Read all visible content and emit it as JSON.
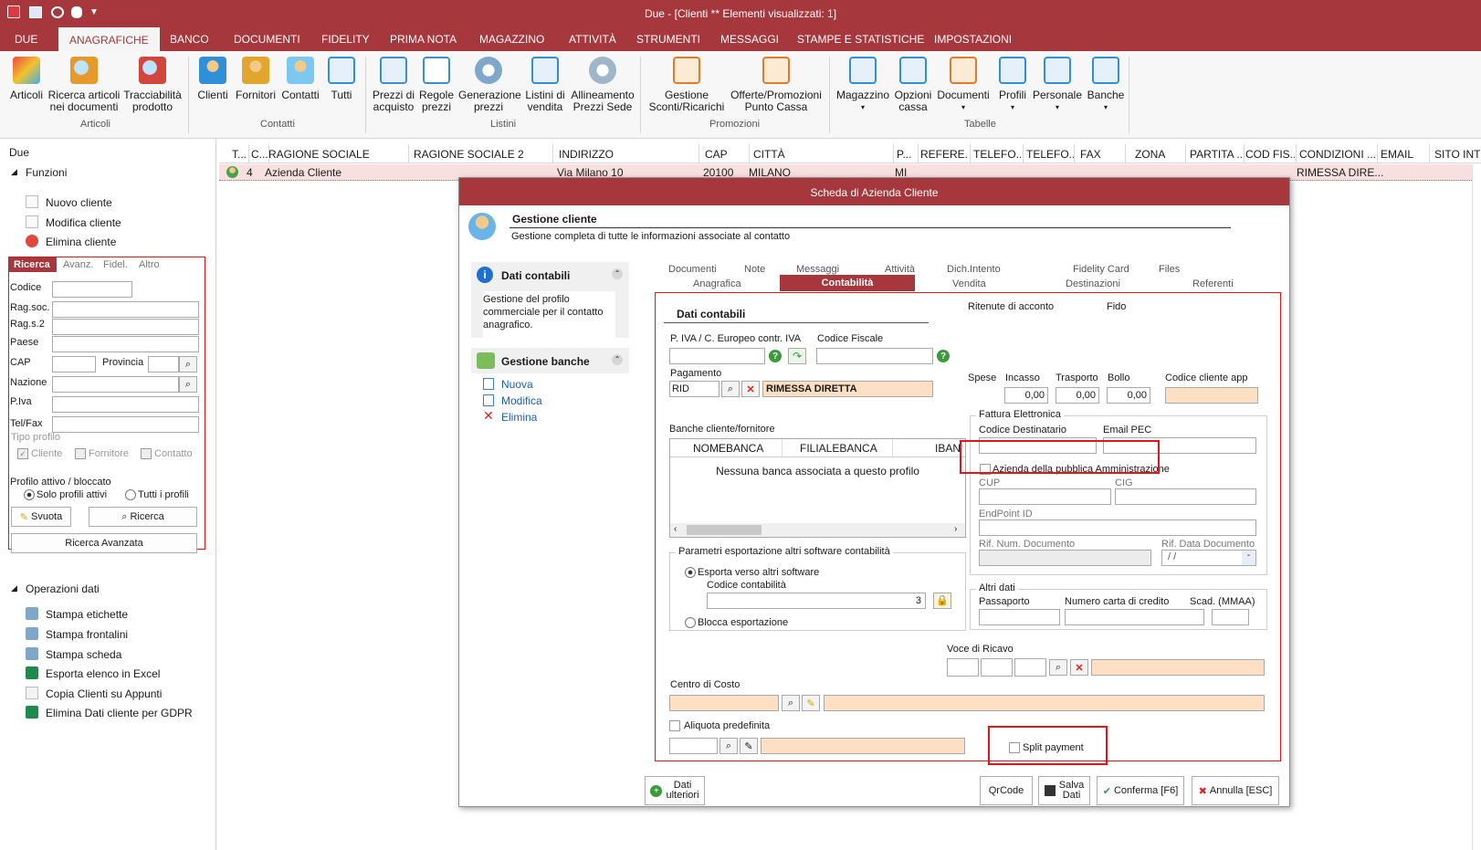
{
  "app": {
    "title": "Due - [Clienti ** Elementi visualizzati: 1]",
    "colors": {
      "brand": "#a5373d",
      "highlight": "#e3141a",
      "peach": "#fddfc4",
      "row_selected": "#f8dfe0"
    }
  },
  "ribbon": {
    "tabs": [
      "DUE",
      "ANAGRAFICHE",
      "BANCO",
      "DOCUMENTI",
      "FIDELITY",
      "PRIMA NOTA",
      "MAGAZZINO",
      "ATTIVITÀ",
      "STRUMENTI",
      "MESSAGGI",
      "STAMPE E STATISTICHE",
      "IMPOSTAZIONI"
    ],
    "active_tab": "ANAGRAFICHE",
    "buttons": {
      "articoli": "Articoli",
      "ricerca_articoli": "Ricerca articoli\nnei documenti",
      "tracciabilita": "Tracciabilità\nprodotto",
      "clienti": "Clienti",
      "fornitori": "Fornitori",
      "contatti": "Contatti",
      "tutti": "Tutti",
      "prezzi_acquisto": "Prezzi di\nacquisto",
      "regole_prezzi": "Regole\nprezzi",
      "generazione_prezzi": "Generazione\nprezzi",
      "listini_vendita": "Listini di\nvendita",
      "allineamento": "Allineamento\nPrezzi Sede",
      "gestione_sconti": "Gestione\nSconti/Ricarichi",
      "offerte": "Offerte/Promozioni\nPunto Cassa",
      "magazzino": "Magazzino",
      "opzioni_cassa": "Opzioni\ncassa",
      "documenti": "Documenti",
      "profili": "Profili",
      "personale": "Personale",
      "banche": "Banche"
    },
    "groups": {
      "articoli": "Articoli",
      "contatti": "Contatti",
      "listini": "Listini",
      "promozioni": "Promozioni",
      "tabelle": "Tabelle"
    }
  },
  "left": {
    "root": "Due",
    "funzioni_title": "Funzioni",
    "funzioni": [
      "Nuovo cliente",
      "Modifica cliente",
      "Elimina cliente"
    ],
    "search_tabs": [
      "Ricerca",
      "Avanz.",
      "Fidel.",
      "Altro"
    ],
    "labels": {
      "codice": "Codice",
      "ragsoc": "Rag.soc.",
      "rags2": "Rag.s.2",
      "paese": "Paese",
      "cap": "CAP",
      "provincia": "Provincia",
      "nazione": "Nazione",
      "piva": "P.Iva",
      "telfax": "Tel/Fax",
      "tipo_profilo": "Tipo profilo",
      "cliente": "Cliente",
      "fornitore": "Fornitore",
      "contatto": "Contatto",
      "profilo_attivo": "Profilo attivo / bloccato",
      "solo_attivi": "Solo profili attivi",
      "tutti_profili": "Tutti i profili"
    },
    "buttons": {
      "svuota": "Svuota",
      "ricerca": "Ricerca",
      "ricerca_avanzata": "Ricerca Avanzata"
    },
    "operazioni_title": "Operazioni dati",
    "operazioni": [
      "Stampa etichette",
      "Stampa frontalini",
      "Stampa scheda",
      "Esporta elenco in Excel",
      "Copia Clienti su Appunti",
      "Elimina Dati cliente per GDPR"
    ]
  },
  "grid": {
    "columns": [
      "T...",
      "C...",
      "RAGIONE SOCIALE",
      "RAGIONE SOCIALE 2",
      "INDIRIZZO",
      "CAP",
      "CITTÀ",
      "P...",
      "REFERE...",
      "TELEFO...",
      "TELEFO...",
      "FAX",
      "ZONA",
      "PARTITA ...",
      "COD FIS...",
      "CONDIZIONI ...",
      "EMAIL",
      "SITO INT..."
    ],
    "row": {
      "code": "4",
      "ragione_sociale": "Azienda Cliente",
      "indirizzo": "Via Milano 10",
      "cap": "20100",
      "citta": "MILANO",
      "prov": "MI",
      "condizioni": "RIMESSA DIRE..."
    }
  },
  "dialog": {
    "title": "Scheda di Azienda Cliente",
    "header_title": "Gestione cliente",
    "header_sub": "Gestione completa di tutte le informazioni associate al contatto",
    "side": {
      "dati_contabili_title": "Dati contabili",
      "dati_contabili_desc": "Gestione del profilo commerciale per il contatto anagrafico.",
      "banche_title": "Gestione banche",
      "banche_actions": [
        "Nuova",
        "Modifica",
        "Elimina"
      ]
    },
    "tabs_top": [
      "Documenti",
      "Note",
      "Messaggi",
      "Attività",
      "Dich.Intento",
      "Fidelity Card",
      "Files"
    ],
    "tabs_bottom": [
      "Anagrafica",
      "Contabilità",
      "Vendita",
      "Destinazioni",
      "Referenti"
    ],
    "active_tab": "Contabilità",
    "form": {
      "section_title": "Dati contabili",
      "piva_label": "P. IVA / C. Europeo contr. IVA",
      "cf_label": "Codice Fiscale",
      "pagamento_label": "Pagamento",
      "pagamento_code": "RID",
      "pagamento_desc": "RIMESSA DIRETTA",
      "banche_label": "Banche cliente/fornitore",
      "banche_cols": [
        "NOMEBANCA",
        "FILIALEBANCA",
        "IBAN"
      ],
      "banche_empty": "Nessuna banca associata a questo profilo",
      "export_group": "Parametri esportazione altri software contabilità",
      "export_radio": "Esporta verso altri software",
      "codice_contabilita_label": "Codice contabilità",
      "codice_contabilita": "3",
      "blocca_radio": "Blocca esportazione",
      "ritenute": "Ritenute di acconto",
      "fido": "Fido",
      "spese": "Spese",
      "incasso_label": "Incasso",
      "incasso": "0,00",
      "trasporto_label": "Trasporto",
      "trasporto": "0,00",
      "bollo_label": "Bollo",
      "bollo": "0,00",
      "codice_app_label": "Codice cliente app",
      "fe_group": "Fattura Elettronica",
      "codice_dest_label": "Codice Destinatario",
      "email_pec_label": "Email PEC",
      "pa_checkbox": "Azienda della pubblica Amministrazione",
      "cup_label": "CUP",
      "cig_label": "CIG",
      "endpoint_label": "EndPoint ID",
      "rif_num_label": "Rif. Num. Documento",
      "rif_data_label": "Rif. Data Documento",
      "rif_data_value": " / /",
      "altri_group": "Altri dati",
      "passaporto_label": "Passaporto",
      "carta_label": "Numero carta di credito",
      "scad_label": "Scad. (MMAA)",
      "voce_ricavo_label": "Voce di Ricavo",
      "centro_costo_label": "Centro di Costo",
      "aliquota_label": "Aliquota predefinita",
      "split_label": "Split payment"
    },
    "footer": {
      "dati_ulteriori": "Dati\nulteriori",
      "qrcode": "QrCode",
      "salva": "Salva\nDati",
      "conferma": "Conferma [F6]",
      "annulla": "Annulla [ESC]"
    }
  }
}
